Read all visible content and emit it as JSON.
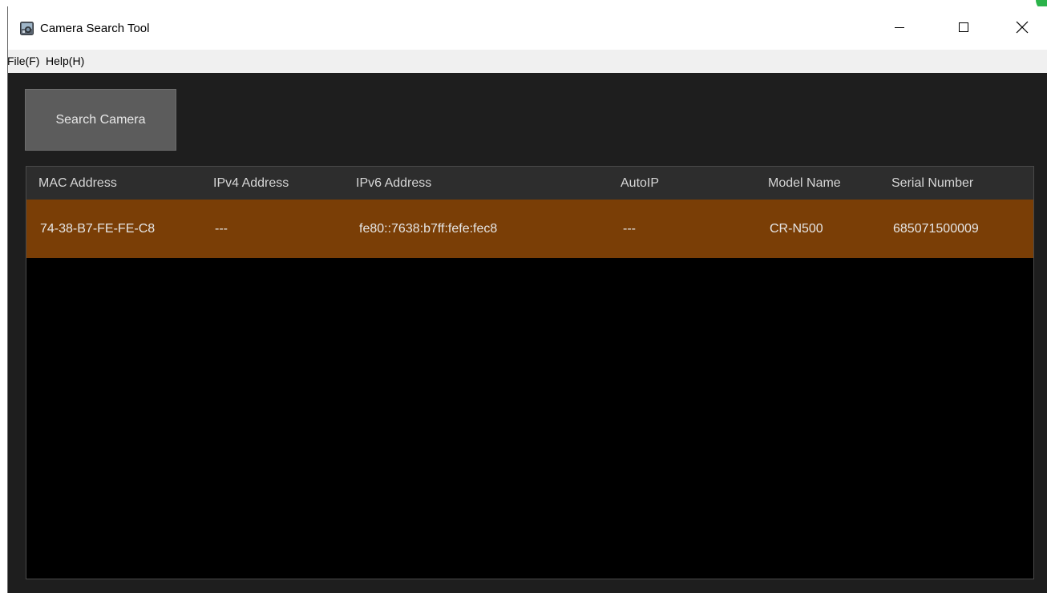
{
  "window": {
    "title": "Camera Search Tool",
    "controls": {
      "minimize_icon": "minimize-icon",
      "maximize_icon": "maximize-icon",
      "close_icon": "close-icon"
    }
  },
  "menu": {
    "items": [
      {
        "label": "File(F)"
      },
      {
        "label": "Help(H)"
      }
    ]
  },
  "toolbar": {
    "search_label": "Search Camera"
  },
  "table": {
    "columns": [
      "MAC Address",
      "IPv4 Address",
      "IPv6 Address",
      "AutoIP",
      "Model Name",
      "Serial Number"
    ],
    "rows": [
      {
        "mac": "74-38-B7-FE-FE-C8",
        "ipv4": "---",
        "ipv6": "fe80::7638:b7ff:fefe:fec8",
        "autoip": "---",
        "model": "CR-N500",
        "serial": "685071500009",
        "selected": true
      }
    ]
  },
  "colors": {
    "background": "#1e1e1e",
    "table_background": "#000000",
    "header_background": "#2d2d2d",
    "selected_row": "#7a3e06",
    "button": "#5c5c5c"
  }
}
